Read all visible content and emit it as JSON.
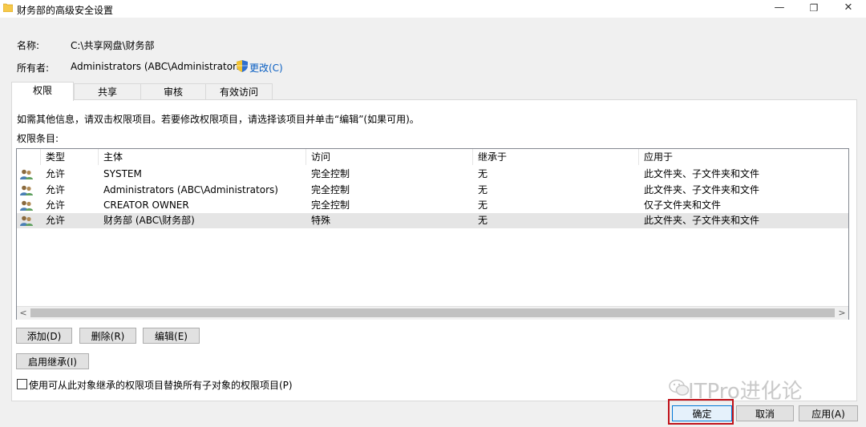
{
  "window": {
    "title": "财务部的高级安全设置",
    "controls": {
      "minimize": "—",
      "maximize": "❐",
      "close": "✕"
    }
  },
  "info": {
    "name_label": "名称:",
    "name_value": "C:\\共享网盘\\财务部",
    "owner_label": "所有者:",
    "owner_value": "Administrators (ABC\\Administrators)",
    "change_link": "更改(C)"
  },
  "tabs": [
    {
      "label": "权限",
      "active": true
    },
    {
      "label": "共享",
      "active": false
    },
    {
      "label": "审核",
      "active": false
    },
    {
      "label": "有效访问",
      "active": false
    }
  ],
  "permissions": {
    "hint": "如需其他信息，请双击权限项目。若要修改权限项目，请选择该项目并单击“编辑”(如果可用)。",
    "entries_label": "权限条目:",
    "columns": [
      "类型",
      "主体",
      "访问",
      "继承于",
      "应用于"
    ],
    "rows": [
      {
        "type": "允许",
        "principal": "SYSTEM",
        "access": "完全控制",
        "inherited": "无",
        "applies": "此文件夹、子文件夹和文件",
        "selected": false
      },
      {
        "type": "允许",
        "principal": "Administrators (ABC\\Administrators)",
        "access": "完全控制",
        "inherited": "无",
        "applies": "此文件夹、子文件夹和文件",
        "selected": false
      },
      {
        "type": "允许",
        "principal": "CREATOR OWNER",
        "access": "完全控制",
        "inherited": "无",
        "applies": "仅子文件夹和文件",
        "selected": false
      },
      {
        "type": "允许",
        "principal": "财务部 (ABC\\财务部)",
        "access": "特殊",
        "inherited": "无",
        "applies": "此文件夹、子文件夹和文件",
        "selected": true
      }
    ],
    "scroll_left": "<",
    "scroll_right": ">"
  },
  "actions": {
    "add": "添加(D)",
    "remove": "删除(R)",
    "edit": "编辑(E)",
    "enable_inheritance": "启用继承(I)",
    "replace_checkbox_label": "使用可从此对象继承的权限项目替换所有子对象的权限项目(P)",
    "replace_checked": false
  },
  "footer": {
    "ok": "确定",
    "cancel": "取消",
    "apply": "应用(A)"
  },
  "watermark": "ITPro进化论",
  "colors": {
    "link": "#0a5fc2",
    "highlight": "#c0121a",
    "selected_row": "#e5e5e5"
  }
}
